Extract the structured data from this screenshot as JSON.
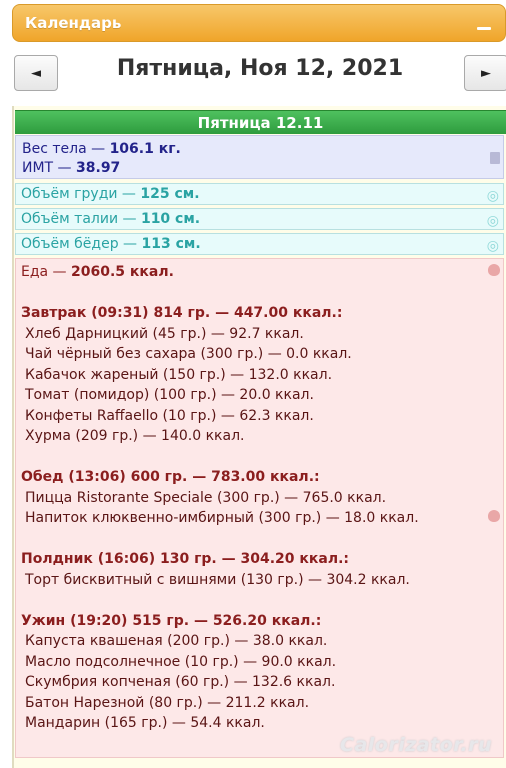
{
  "panel": {
    "title": "Календарь"
  },
  "nav": {
    "prev_label": "◄",
    "next_label": "►",
    "date_title": "Пятница, Ноя 12, 2021"
  },
  "day_header": "Пятница 12.11",
  "body_stats": {
    "weight_label": "Вес тела — ",
    "weight_value": "106.1 кг.",
    "bmi_label": "ИМТ — ",
    "bmi_value": "38.97"
  },
  "measurements": [
    {
      "label": "Объём груди — ",
      "value": "125 см."
    },
    {
      "label": "Объём талии — ",
      "value": "110 см."
    },
    {
      "label": "Объём бёдер — ",
      "value": "113 см."
    }
  ],
  "food": {
    "total_label": "Еда — ",
    "total_value": "2060.5 ккал.",
    "meals": [
      {
        "header": "Завтрак (09:31) 814 гр. — 447.00 ккал.:",
        "items": [
          "Хлеб Дарницкий (45 гр.) — 92.7 ккал.",
          "Чай чёрный без сахара (300 гр.) — 0.0 ккал.",
          "Кабачок жареный (150 гр.) — 132.0 ккал.",
          "Томат (помидор) (100 гр.) — 20.0 ккал.",
          "Конфеты Raffaello (10 гр.) — 62.3 ккал.",
          "Хурма (209 гр.) — 140.0 ккал."
        ]
      },
      {
        "header": "Обед (13:06) 600 гр. — 783.00 ккал.:",
        "items": [
          "Пицца Ristorante Speciale (300 гр.) — 765.0 ккал.",
          "Напиток клюквенно-имбирный (300 гр.) — 18.0 ккал."
        ]
      },
      {
        "header": "Полдник (16:06) 130 гр. — 304.20 ккал.:",
        "items": [
          "Торт бисквитный с вишнями (130 гр.) — 304.2 ккал."
        ]
      },
      {
        "header": "Ужин (19:20) 515 гр. — 526.20 ккал.:",
        "items": [
          "Капуста квашеная (200 гр.) — 38.0 ккал.",
          "Масло подсолнечное (10 гр.) — 90.0 ккал.",
          "Скумбрия копченая (60 гр.) — 132.6 ккал.",
          "Батон Нарезной (80 гр.) — 211.2 ккал.",
          "Мандарин (165 гр.) — 54.4 ккал."
        ]
      }
    ]
  },
  "watermark": "Calorizator.ru"
}
